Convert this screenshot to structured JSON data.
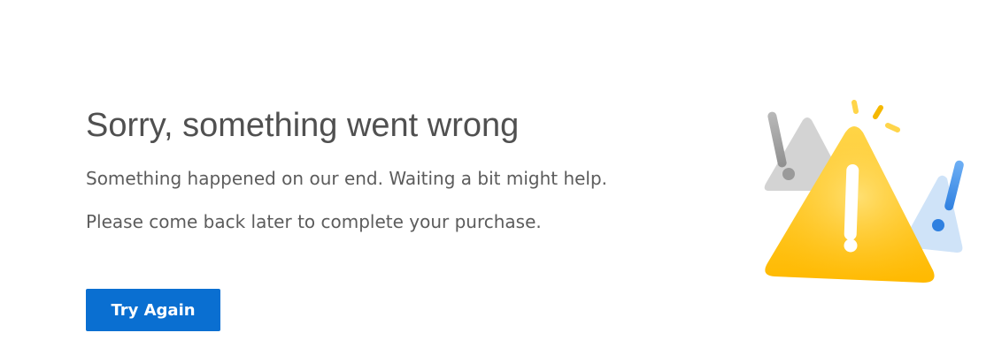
{
  "error": {
    "title": "Sorry, something went wrong",
    "message_line1": "Something happened on our end. Waiting a bit might help.",
    "message_line2": "Please come back later to complete your purchase."
  },
  "actions": {
    "try_again_label": "Try Again"
  },
  "illustration": {
    "icon": "warning-triangles-icon"
  },
  "colors": {
    "title": "#505050",
    "text": "#5c5c5c",
    "button": "#0a6fd1",
    "warning": "#ffc21a",
    "gray_triangle": "#d2d2d2",
    "blue_triangle": "#cfe3f8",
    "blue_accent": "#2f80e0"
  }
}
